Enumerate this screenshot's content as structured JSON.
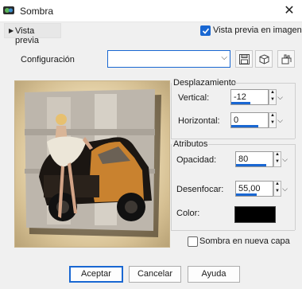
{
  "window": {
    "title": "Sombra"
  },
  "preview": {
    "toggle_label": "Vista previa",
    "live_label": "Vista previa en imagen",
    "live_checked": true
  },
  "config": {
    "label": "Configuración",
    "value": ""
  },
  "displacement": {
    "title": "Desplazamiento",
    "vertical": {
      "label": "Vertical:",
      "value": "-12",
      "level": 0.5
    },
    "horizontal": {
      "label": "Horizontal:",
      "value": "0",
      "level": 0.55
    }
  },
  "attributes": {
    "title": "Atributos",
    "opacity": {
      "label": "Opacidad:",
      "value": "80",
      "level": 0.8
    },
    "blur": {
      "label": "Desenfocar:",
      "value": "55,00",
      "level": 0.55
    },
    "color": {
      "label": "Color:",
      "value": "#000000"
    }
  },
  "shadow_on_layer": {
    "label": "Sombra en nueva capa",
    "checked": false
  },
  "buttons": {
    "ok": "Aceptar",
    "cancel": "Cancelar",
    "help": "Ayuda"
  },
  "colors": {
    "accent": "#1967d2"
  }
}
